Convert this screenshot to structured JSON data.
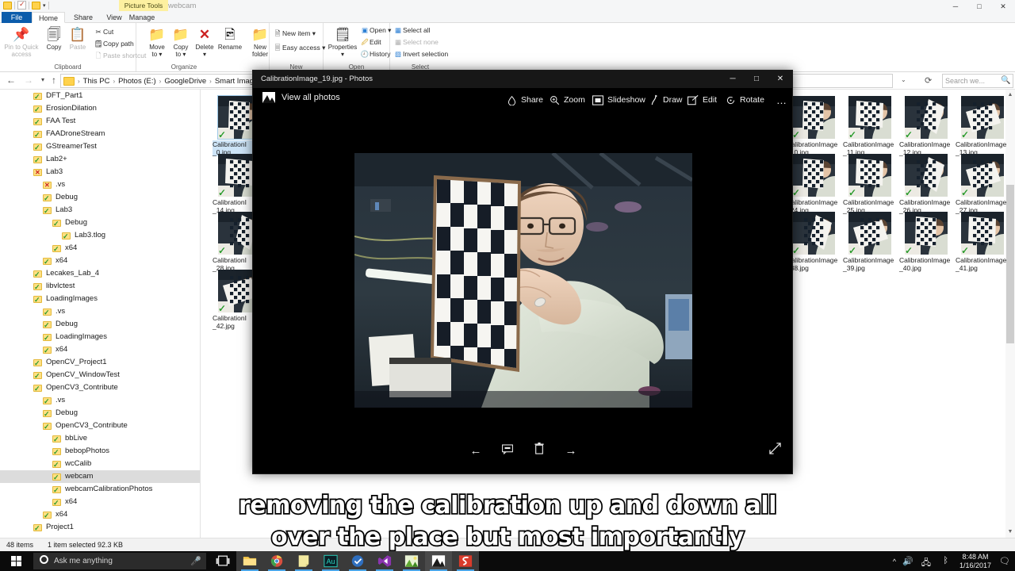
{
  "explorer": {
    "window_title": "webcam",
    "contextual_tab_group": "Picture Tools",
    "quick_access": [
      "folder-icon",
      "properties-checkbox-icon",
      "folder-icon",
      "customize-dropdown-icon"
    ],
    "window_controls": {
      "minimize": "─",
      "maximize": "□",
      "close": "✕"
    },
    "tabs": [
      {
        "label": "File"
      },
      {
        "label": "Home"
      },
      {
        "label": "Share"
      },
      {
        "label": "View"
      },
      {
        "label": "Manage"
      }
    ],
    "ribbon": {
      "groups": [
        {
          "label": "Clipboard"
        },
        {
          "label": "Organize"
        },
        {
          "label": "New"
        },
        {
          "label": "Open"
        },
        {
          "label": "Select"
        }
      ],
      "clipboard": {
        "pin_to_quick_access": "Pin to Quick\naccess",
        "pin_line1": "Pin to Quick",
        "pin_line2": "access",
        "copy": "Copy",
        "paste": "Paste",
        "cut": "Cut",
        "copy_path": "Copy path",
        "paste_shortcut": "Paste shortcut"
      },
      "organize": {
        "move_to": "Move\nto",
        "move_line1": "Move",
        "move_line2": "to",
        "copy_to_line1": "Copy",
        "copy_to_line2": "to",
        "delete": "Delete",
        "rename": "Rename",
        "new_folder_line1": "New",
        "new_folder_line2": "folder"
      },
      "new_group": {
        "new_item": "New item",
        "easy_access": "Easy access"
      },
      "open_group": {
        "properties": "Properties",
        "open": "Open",
        "edit": "Edit",
        "history": "History"
      },
      "select_group": {
        "select_all": "Select all",
        "select_none": "Select none",
        "invert_selection": "Invert selection"
      }
    },
    "address": {
      "breadcrumbs": [
        "This PC",
        "Photos (E:)",
        "GoogleDrive",
        "Smart Imaging and"
      ],
      "refresh_icon": "refresh-icon",
      "dropdown_icon": "chevron-down-icon"
    },
    "search": {
      "placeholder": "Search we...",
      "icon": "search-icon"
    },
    "nav_tree": [
      {
        "label": "DFT_Part1",
        "indent": 0,
        "state": "ok"
      },
      {
        "label": "ErosionDilation",
        "indent": 0,
        "state": "ok"
      },
      {
        "label": "FAA Test",
        "indent": 0,
        "state": "ok"
      },
      {
        "label": "FAADroneStream",
        "indent": 0,
        "state": "ok"
      },
      {
        "label": "GStreamerTest",
        "indent": 0,
        "state": "ok"
      },
      {
        "label": "Lab2+",
        "indent": 0,
        "state": "ok"
      },
      {
        "label": "Lab3",
        "indent": 0,
        "state": "err"
      },
      {
        "label": ".vs",
        "indent": 1,
        "state": "err"
      },
      {
        "label": "Debug",
        "indent": 1,
        "state": "ok"
      },
      {
        "label": "Lab3",
        "indent": 1,
        "state": "ok"
      },
      {
        "label": "Debug",
        "indent": 2,
        "state": "ok"
      },
      {
        "label": "Lab3.tlog",
        "indent": 3,
        "state": "ok"
      },
      {
        "label": "x64",
        "indent": 2,
        "state": "ok"
      },
      {
        "label": "x64",
        "indent": 1,
        "state": "ok"
      },
      {
        "label": "Lecakes_Lab_4",
        "indent": 0,
        "state": "ok"
      },
      {
        "label": "libvlctest",
        "indent": 0,
        "state": "ok"
      },
      {
        "label": "LoadingImages",
        "indent": 0,
        "state": "ok"
      },
      {
        "label": ".vs",
        "indent": 1,
        "state": "ok"
      },
      {
        "label": "Debug",
        "indent": 1,
        "state": "ok"
      },
      {
        "label": "LoadingImages",
        "indent": 1,
        "state": "ok"
      },
      {
        "label": "x64",
        "indent": 1,
        "state": "ok"
      },
      {
        "label": "OpenCV_Project1",
        "indent": 0,
        "state": "ok"
      },
      {
        "label": "OpenCV_WindowTest",
        "indent": 0,
        "state": "ok"
      },
      {
        "label": "OpenCV3_Contribute",
        "indent": 0,
        "state": "ok"
      },
      {
        "label": ".vs",
        "indent": 1,
        "state": "ok"
      },
      {
        "label": "Debug",
        "indent": 1,
        "state": "ok"
      },
      {
        "label": "OpenCV3_Contribute",
        "indent": 1,
        "state": "ok"
      },
      {
        "label": "bbLive",
        "indent": 2,
        "state": "ok"
      },
      {
        "label": "bebopPhotos",
        "indent": 2,
        "state": "ok"
      },
      {
        "label": "wcCalib",
        "indent": 2,
        "state": "ok"
      },
      {
        "label": "webcam",
        "indent": 2,
        "state": "ok",
        "selected": true
      },
      {
        "label": "webcamCalibrationPhotos",
        "indent": 2,
        "state": "ok"
      },
      {
        "label": "x64",
        "indent": 2,
        "state": "ok"
      },
      {
        "label": "x64",
        "indent": 1,
        "state": "ok"
      },
      {
        "label": "Project1",
        "indent": 0,
        "state": "ok"
      }
    ],
    "left_thumbnails": [
      {
        "line1": "CalibrationI",
        "line2": "_0.jpg",
        "selected": true
      },
      {
        "line1": "CalibrationI",
        "line2": "_14.jpg"
      },
      {
        "line1": "CalibrationI",
        "line2": "_28.jpg"
      },
      {
        "line1": "CalibrationI",
        "line2": "_42.jpg"
      }
    ],
    "right_thumbnails": [
      {
        "line1": "CalibrationImage",
        "line2": "_10.jpg"
      },
      {
        "line1": "CalibrationImage",
        "line2": "_11.jpg"
      },
      {
        "line1": "CalibrationImage",
        "line2": "_12.jpg"
      },
      {
        "line1": "CalibrationImage",
        "line2": "_13.jpg"
      },
      {
        "line1": "CalibrationImage",
        "line2": "_24.jpg"
      },
      {
        "line1": "CalibrationImage",
        "line2": "_25.jpg"
      },
      {
        "line1": "CalibrationImage",
        "line2": "_26.jpg"
      },
      {
        "line1": "CalibrationImage",
        "line2": "_27.jpg"
      },
      {
        "line1": "CalibrationImage",
        "line2": "_38.jpg"
      },
      {
        "line1": "CalibrationImage",
        "line2": "_39.jpg"
      },
      {
        "line1": "CalibrationImage",
        "line2": "_40.jpg"
      },
      {
        "line1": "CalibrationImage",
        "line2": "_41.jpg"
      }
    ],
    "status": {
      "items": "48 items",
      "selection": "1 item selected  92.3 KB"
    }
  },
  "photos_app": {
    "title": "CalibrationImage_19.jpg - Photos",
    "window_controls": {
      "minimize": "─",
      "maximize": "□",
      "close": "✕"
    },
    "view_all": "View all photos",
    "toolbar": [
      {
        "label": "Share",
        "icon": "share-icon"
      },
      {
        "label": "Zoom",
        "icon": "zoom-icon"
      },
      {
        "label": "Slideshow",
        "icon": "slideshow-icon"
      },
      {
        "label": "Draw",
        "icon": "draw-icon"
      },
      {
        "label": "Edit",
        "icon": "edit-icon"
      },
      {
        "label": "Rotate",
        "icon": "rotate-icon"
      },
      {
        "label": "…",
        "icon": "more-icon"
      }
    ],
    "bottom_controls": [
      {
        "icon": "previous-arrow-icon"
      },
      {
        "icon": "comment-icon"
      },
      {
        "icon": "delete-icon"
      },
      {
        "icon": "next-arrow-icon"
      },
      {
        "icon": "fullscreen-icon"
      }
    ],
    "photo_description": "Person holding a black and white checkerboard calibration target toward the camera"
  },
  "subtitles": {
    "line1": "removing the calibration up and down all",
    "line2": "over the place but most importantly"
  },
  "taskbar": {
    "search_placeholder": "Ask me anything",
    "search_icon": "cortana-circle-icon",
    "mic_icon": "microphone-icon",
    "icons": [
      {
        "name": "task-view-icon"
      },
      {
        "name": "file-explorer-icon",
        "active": true
      },
      {
        "name": "chrome-icon",
        "active": true
      },
      {
        "name": "sticky-notes-icon",
        "active": true
      },
      {
        "name": "adobe-audition-icon",
        "active": true
      },
      {
        "name": "dropbox-icon",
        "active": true
      },
      {
        "name": "visual-studio-icon",
        "active": true
      },
      {
        "name": "paint-icon",
        "active": true
      },
      {
        "name": "photos-icon",
        "active": true
      },
      {
        "name": "snagit-icon",
        "active": true
      }
    ],
    "tray": {
      "chevron_icon": "show-hidden-icons-icon",
      "volume_icon": "volume-icon",
      "network_icon": "network-icon",
      "bluetooth_icon": "bluetooth-icon",
      "time": "8:48 AM",
      "date": "1/16/2017",
      "action_center_icon": "action-center-icon"
    }
  },
  "colors": {
    "accent_blue": "#0b5cab",
    "contextual_yellow": "#fdf0a0",
    "photos_bg": "#000000",
    "selection_gray": "#dcdcdc",
    "folder_yellow": "#ffd24d",
    "taskbar_bg": "#0b0b0b"
  }
}
